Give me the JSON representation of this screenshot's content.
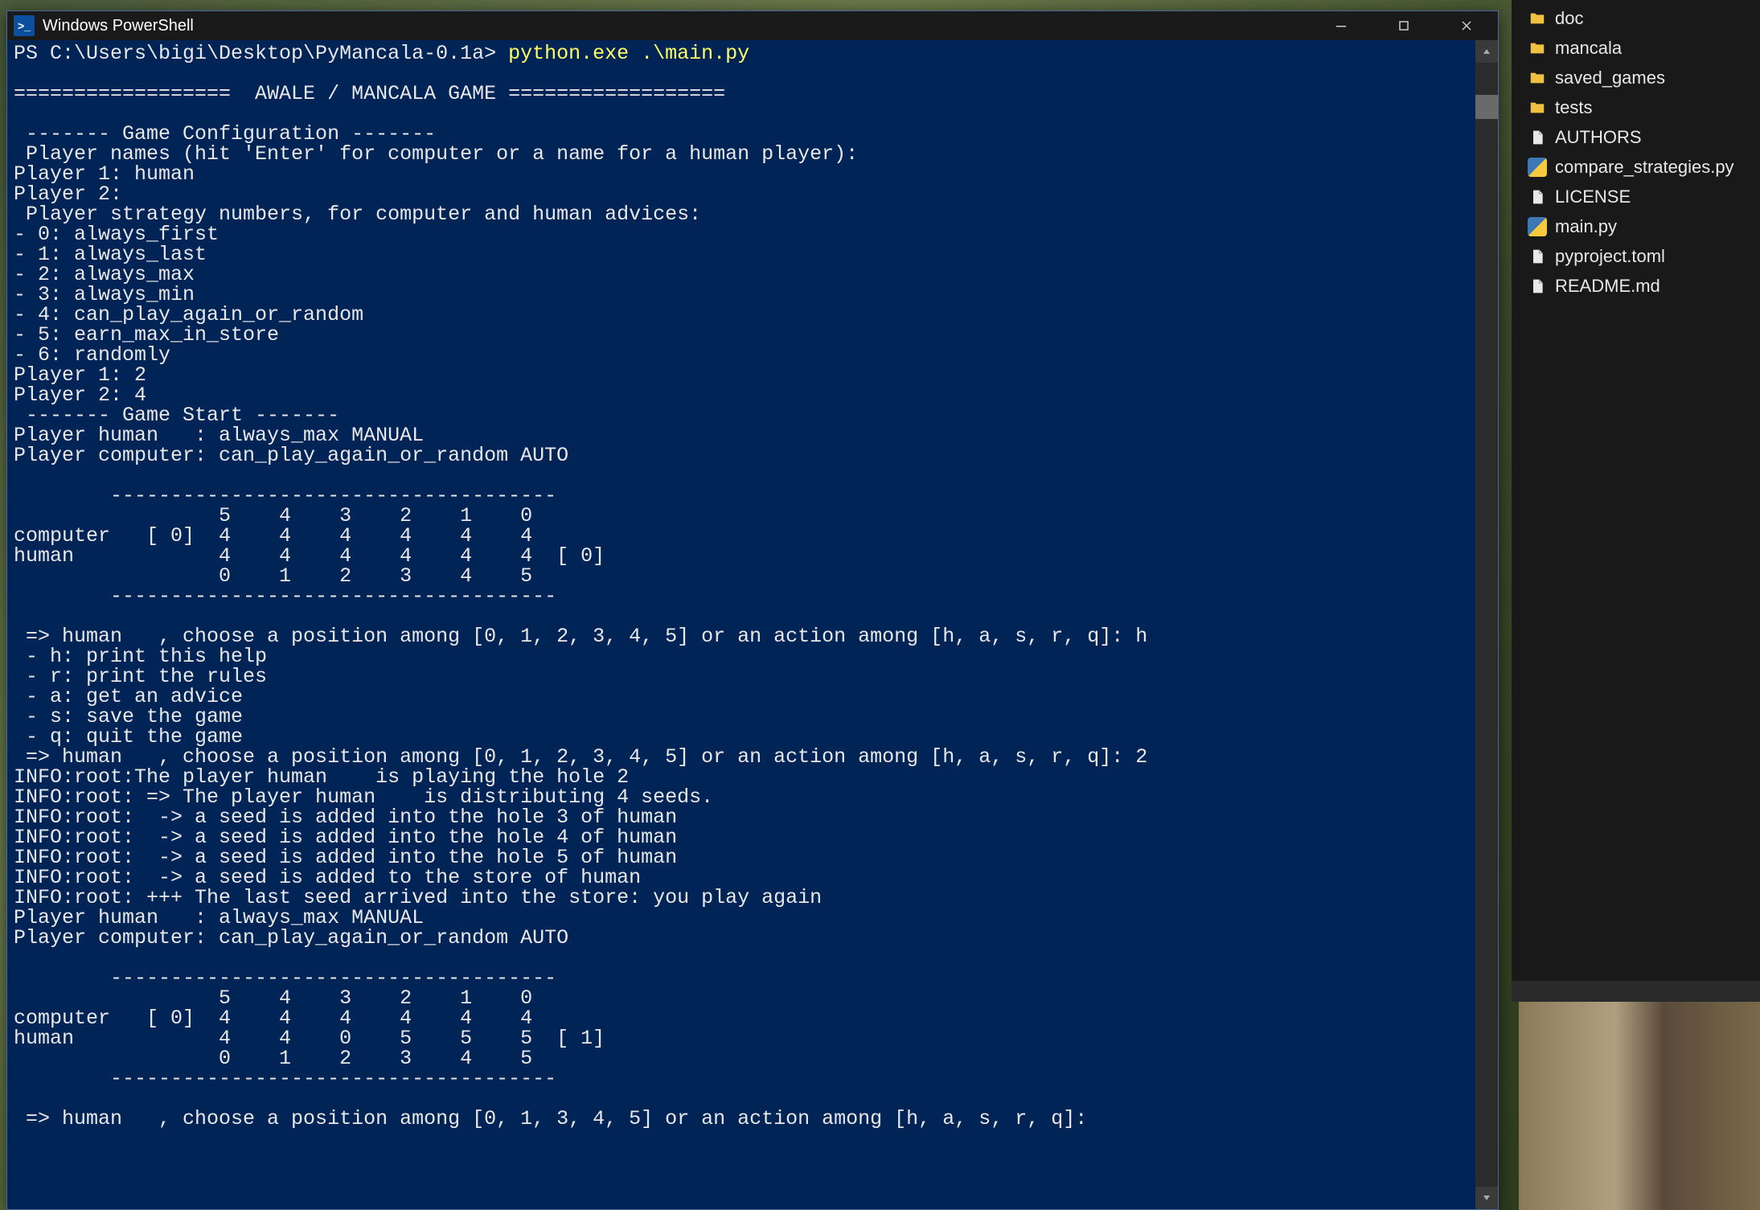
{
  "window": {
    "title": "Windows PowerShell",
    "icon_label": ">_"
  },
  "terminal": {
    "prompt_path": "PS C:\\Users\\bigi\\Desktop\\PyMancala-0.1a> ",
    "prompt_cmd": "python.exe .\\main.py",
    "lines": [
      "",
      "==================  AWALE / MANCALA GAME ==================",
      "",
      " ------- Game Configuration -------",
      " Player names (hit 'Enter' for computer or a name for a human player):",
      "Player 1: human",
      "Player 2:",
      " Player strategy numbers, for computer and human advices:",
      "- 0: always_first",
      "- 1: always_last",
      "- 2: always_max",
      "- 3: always_min",
      "- 4: can_play_again_or_random",
      "- 5: earn_max_in_store",
      "- 6: randomly",
      "Player 1: 2",
      "Player 2: 4",
      " ------- Game Start -------",
      "Player human   : always_max MANUAL",
      "Player computer: can_play_again_or_random AUTO",
      "",
      "        -------------------------------------",
      "                 5    4    3    2    1    0",
      "computer   [ 0]  4    4    4    4    4    4",
      "human            4    4    4    4    4    4  [ 0]",
      "                 0    1    2    3    4    5",
      "        -------------------------------------",
      "",
      " => human   , choose a position among [0, 1, 2, 3, 4, 5] or an action among [h, a, s, r, q]: h",
      " - h: print this help",
      " - r: print the rules",
      " - a: get an advice",
      " - s: save the game",
      " - q: quit the game",
      " => human   , choose a position among [0, 1, 2, 3, 4, 5] or an action among [h, a, s, r, q]: 2",
      "INFO:root:The player human    is playing the hole 2",
      "INFO:root: => The player human    is distributing 4 seeds.",
      "INFO:root:  -> a seed is added into the hole 3 of human",
      "INFO:root:  -> a seed is added into the hole 4 of human",
      "INFO:root:  -> a seed is added into the hole 5 of human",
      "INFO:root:  -> a seed is added to the store of human",
      "INFO:root: +++ The last seed arrived into the store: you play again",
      "Player human   : always_max MANUAL",
      "Player computer: can_play_again_or_random AUTO",
      "",
      "        -------------------------------------",
      "                 5    4    3    2    1    0",
      "computer   [ 0]  4    4    4    4    4    4",
      "human            4    4    0    5    5    5  [ 1]",
      "                 0    1    2    3    4    5",
      "        -------------------------------------",
      "",
      " => human   , choose a position among [0, 1, 3, 4, 5] or an action among [h, a, s, r, q]:"
    ]
  },
  "explorer": {
    "items": [
      {
        "type": "folder",
        "name": "doc"
      },
      {
        "type": "folder",
        "name": "mancala"
      },
      {
        "type": "folder",
        "name": "saved_games"
      },
      {
        "type": "folder",
        "name": "tests"
      },
      {
        "type": "file",
        "name": "AUTHORS"
      },
      {
        "type": "py",
        "name": "compare_strategies.py"
      },
      {
        "type": "file",
        "name": "LICENSE"
      },
      {
        "type": "py",
        "name": "main.py"
      },
      {
        "type": "file",
        "name": "pyproject.toml"
      },
      {
        "type": "file",
        "name": "README.md"
      }
    ]
  }
}
